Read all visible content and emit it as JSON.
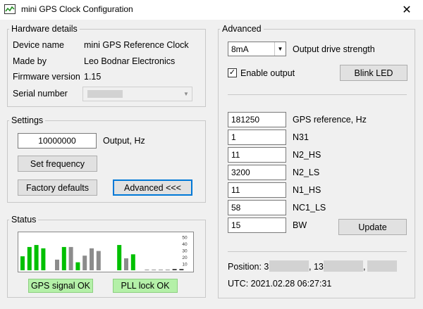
{
  "window": {
    "title": "mini GPS Clock Configuration",
    "close_glyph": "✕"
  },
  "hardware": {
    "title": "Hardware details",
    "device_name_label": "Device name",
    "device_name_value": "mini GPS Reference Clock",
    "made_by_label": "Made by",
    "made_by_value": "Leo Bodnar Electronics",
    "firmware_label": "Firmware version",
    "firmware_value": "1.15",
    "serial_label": "Serial number"
  },
  "settings": {
    "title": "Settings",
    "output_value": "10000000",
    "output_label": "Output, Hz",
    "set_frequency": "Set frequency",
    "factory_defaults": "Factory defaults",
    "advanced_button": "Advanced  <<<"
  },
  "status": {
    "title": "Status",
    "gps_signal": "GPS signal OK",
    "pll_lock": "PLL lock OK",
    "colors": {
      "green": "#00c000",
      "gray": "#8c8c8c",
      "dark": "#404040"
    }
  },
  "chart_data": {
    "type": "bar",
    "yticks": [
      "50",
      "40",
      "30",
      "20",
      "10"
    ],
    "ylim": [
      0,
      55
    ],
    "values": [
      21,
      35,
      38,
      33,
      0,
      16,
      35,
      35,
      12,
      22,
      33,
      29,
      0,
      0,
      38,
      18,
      24,
      0,
      1,
      1,
      1,
      1,
      2,
      2
    ],
    "series_colors": [
      "green",
      "green",
      "green",
      "green",
      "gray",
      "gray",
      "green",
      "gray",
      "green",
      "gray",
      "gray",
      "gray",
      "gray",
      "gray",
      "green",
      "gray",
      "green",
      "gray",
      "gray",
      "gray",
      "gray",
      "gray",
      "dark",
      "dark"
    ]
  },
  "advanced": {
    "title": "Advanced",
    "drive_value": "8mA",
    "drive_label": "Output drive strength",
    "enable_output_label": "Enable output",
    "enable_checked_glyph": "✓",
    "blink_led": "Blink LED",
    "params": [
      {
        "value": "181250",
        "label": "GPS reference, Hz"
      },
      {
        "value": "1",
        "label": "N31"
      },
      {
        "value": "11",
        "label": "N2_HS"
      },
      {
        "value": "3200",
        "label": "N2_LS"
      },
      {
        "value": "11",
        "label": "N1_HS"
      },
      {
        "value": "58",
        "label": "NC1_LS"
      },
      {
        "value": "15",
        "label": "BW"
      }
    ],
    "update": "Update",
    "position_label": "Position: 3",
    "position_sep1": ", 13",
    "position_sep2": ",",
    "utc": "UTC: 2021.02.28 06:27:31"
  }
}
